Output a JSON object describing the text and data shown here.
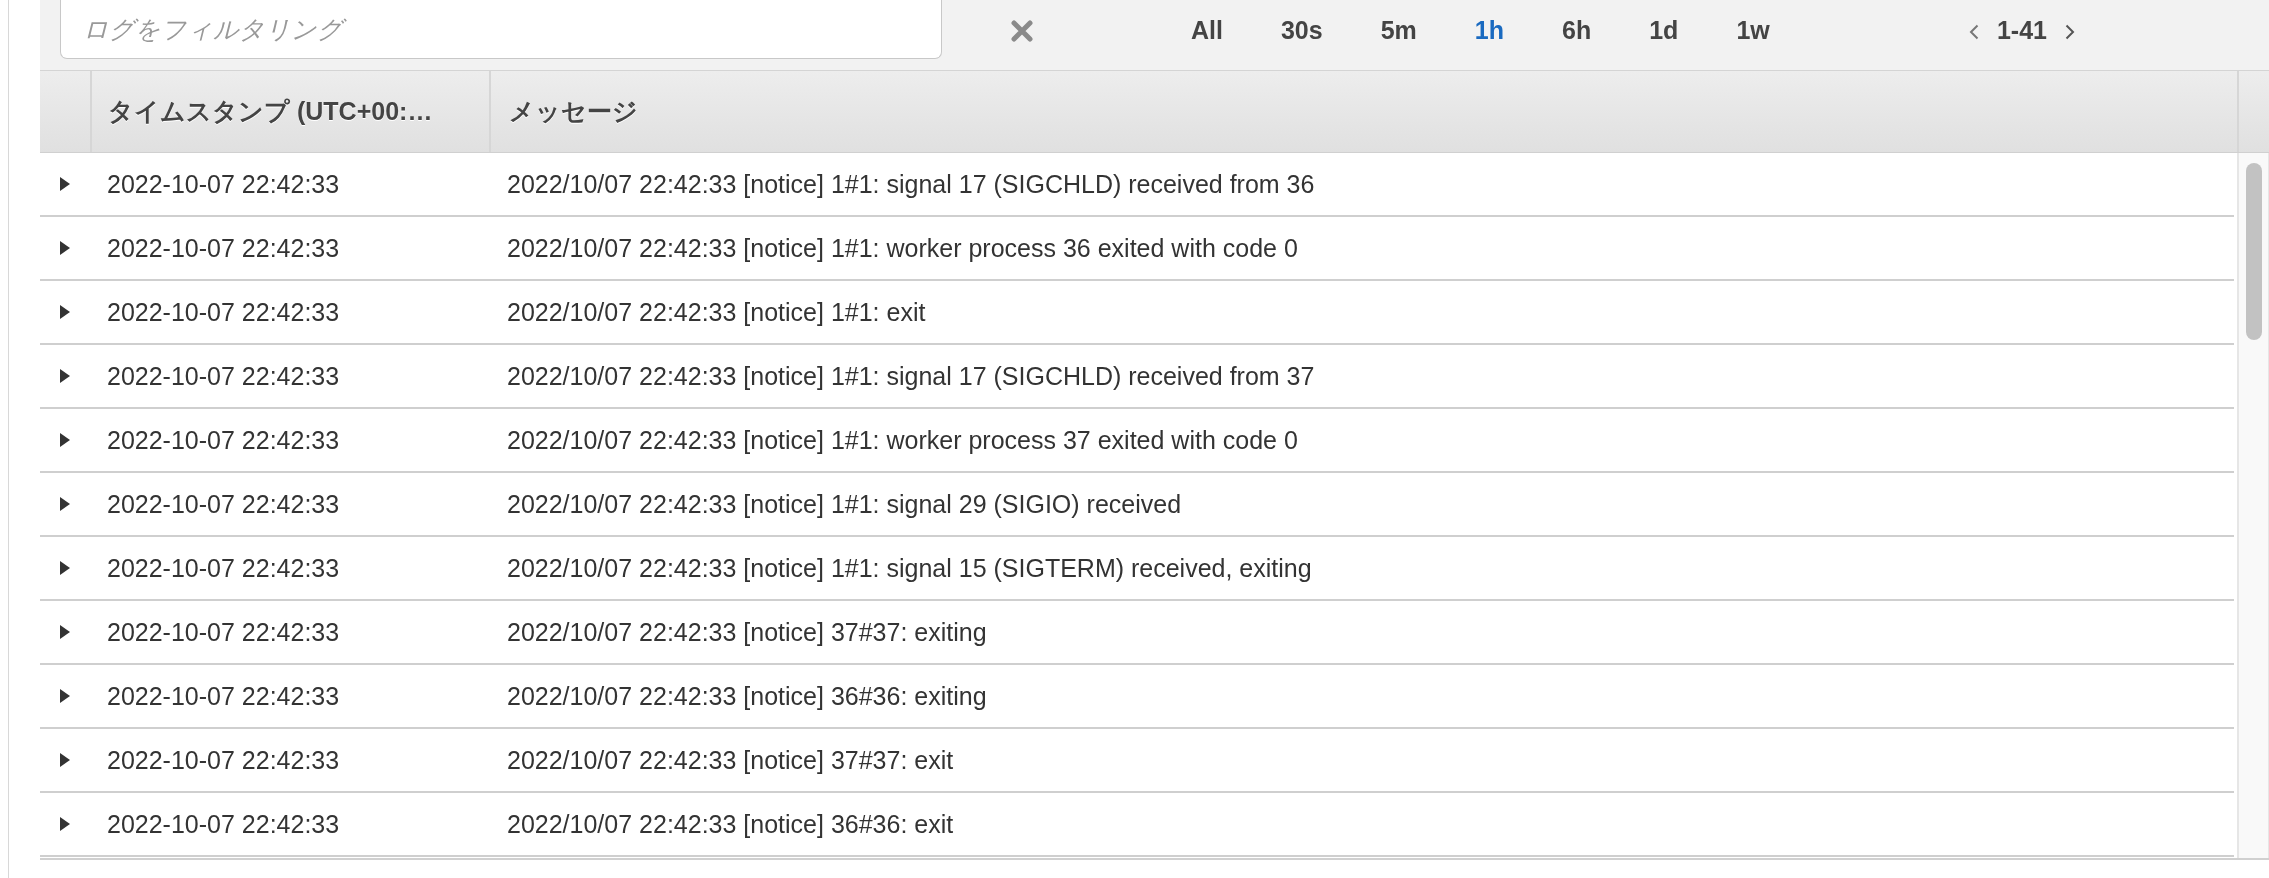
{
  "filter": {
    "placeholder": "ログをフィルタリング"
  },
  "time_ranges": [
    {
      "label": "All",
      "selected": false
    },
    {
      "label": "30s",
      "selected": false
    },
    {
      "label": "5m",
      "selected": false
    },
    {
      "label": "1h",
      "selected": true
    },
    {
      "label": "6h",
      "selected": false
    },
    {
      "label": "1d",
      "selected": false
    },
    {
      "label": "1w",
      "selected": false
    }
  ],
  "pagination": {
    "range": "1-41"
  },
  "table": {
    "columns": [
      "タイムスタンプ (UTC+00:…",
      "メッセージ"
    ],
    "rows": [
      {
        "timestamp": "2022-10-07 22:42:33",
        "message": "2022/10/07 22:42:33 [notice] 1#1: signal 17 (SIGCHLD) received from 36",
        "expanded": false
      },
      {
        "timestamp": "2022-10-07 22:42:33",
        "message": "2022/10/07 22:42:33 [notice] 1#1: worker process 36 exited with code 0",
        "expanded": false
      },
      {
        "timestamp": "2022-10-07 22:42:33",
        "message": "2022/10/07 22:42:33 [notice] 1#1: exit",
        "expanded": false
      },
      {
        "timestamp": "2022-10-07 22:42:33",
        "message": "2022/10/07 22:42:33 [notice] 1#1: signal 17 (SIGCHLD) received from 37",
        "expanded": false
      },
      {
        "timestamp": "2022-10-07 22:42:33",
        "message": "2022/10/07 22:42:33 [notice] 1#1: worker process 37 exited with code 0",
        "expanded": false
      },
      {
        "timestamp": "2022-10-07 22:42:33",
        "message": "2022/10/07 22:42:33 [notice] 1#1: signal 29 (SIGIO) received",
        "expanded": false
      },
      {
        "timestamp": "2022-10-07 22:42:33",
        "message": "2022/10/07 22:42:33 [notice] 1#1: signal 15 (SIGTERM) received, exiting",
        "expanded": false
      },
      {
        "timestamp": "2022-10-07 22:42:33",
        "message": "2022/10/07 22:42:33 [notice] 37#37: exiting",
        "expanded": false
      },
      {
        "timestamp": "2022-10-07 22:42:33",
        "message": "2022/10/07 22:42:33 [notice] 36#36: exiting",
        "expanded": false
      },
      {
        "timestamp": "2022-10-07 22:42:33",
        "message": "2022/10/07 22:42:33 [notice] 37#37: exit",
        "expanded": false
      },
      {
        "timestamp": "2022-10-07 22:42:33",
        "message": "2022/10/07 22:42:33 [notice] 36#36: exit",
        "expanded": false
      }
    ]
  }
}
